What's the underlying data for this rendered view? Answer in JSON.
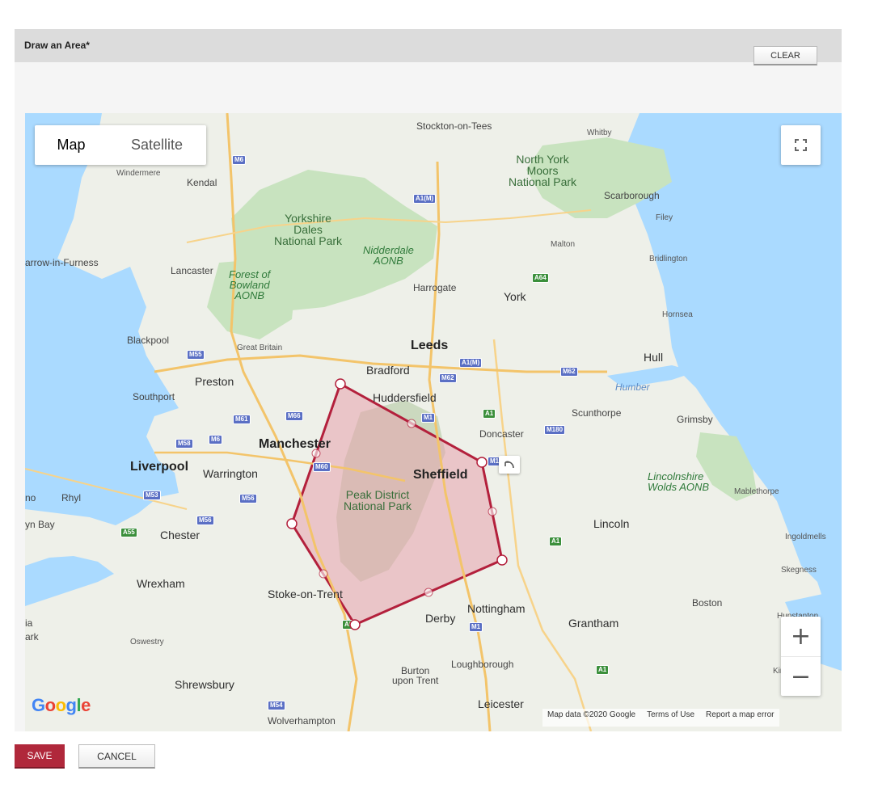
{
  "panel": {
    "title": "Draw an Area*",
    "clear_label": "CLEAR"
  },
  "map": {
    "type_controls": {
      "map": "Map",
      "satellite": "Satellite",
      "selected": "Map"
    },
    "zoom": {
      "in": "+",
      "out": "−"
    },
    "logo": "Google",
    "attribution": {
      "data": "Map data ©2020 Google",
      "terms": "Terms of Use",
      "report": "Report a map error"
    },
    "labels": {
      "stockton": "Stockton-on-Tees",
      "whitby": "Whitby",
      "north_york_moors": "North York\nMoors\nNational Park",
      "scarborough": "Scarborough",
      "filey": "Filey",
      "malton": "Malton",
      "bridlington": "Bridlington",
      "windermere": "Windermere",
      "kendal": "Kendal",
      "yorkshire_dales": "Yorkshire\nDales\nNational Park",
      "nidderdale": "Nidderdale\nAONB",
      "barrow": "arrow-in-Furness",
      "lancaster": "Lancaster",
      "forest_bowland": "Forest of\nBowland\nAONB",
      "harrogate": "Harrogate",
      "york": "York",
      "hornsea": "Hornsea",
      "blackpool": "Blackpool",
      "great_britain": "Great Britain",
      "leeds": "Leeds",
      "hull": "Hull",
      "preston": "Preston",
      "bradford": "Bradford",
      "humber": "Humber",
      "southport": "Southport",
      "huddersfield": "Huddersfield",
      "scunthorpe": "Scunthorpe",
      "grimsby": "Grimsby",
      "manchester": "Manchester",
      "doncaster": "Doncaster",
      "liverpool": "Liverpool",
      "warrington": "Warrington",
      "sheffield": "Sheffield",
      "lincolnshire_wolds": "Lincolnshire\nWolds AONB",
      "mablethorpe": "Mablethorpe",
      "no": "no",
      "rhyl": "Rhyl",
      "peak_district": "Peak District\nNational Park",
      "yn_bay": "yn Bay",
      "chester": "Chester",
      "lincoln": "Lincoln",
      "ingoldmells": "Ingoldmells",
      "skegness": "Skegness",
      "wrexham": "Wrexham",
      "stoke": "Stoke-on-Trent",
      "boston": "Boston",
      "ia": "ia",
      "ark": "ark",
      "derby": "Derby",
      "nottingham": "Nottingham",
      "grantham": "Grantham",
      "hunstanton": "Hunstanton",
      "oswestry": "Oswestry",
      "loughborough": "Loughborough",
      "kin": "King",
      "burton": "Burton\nupon Trent",
      "shrewsbury": "Shrewsbury",
      "leicester": "Leicester",
      "wolverhampton": "Wolverhampton"
    },
    "roads": {
      "m6a": "M6",
      "a1m_n": "A1(M)",
      "a1m_s": "A1(M)",
      "a64": "A64",
      "m55": "M55",
      "m62a": "M62",
      "m62b": "M62",
      "m61": "M61",
      "m66": "M66",
      "m1a": "M1",
      "a1": "A1",
      "m180": "M180",
      "m58": "M58",
      "m6b": "M6",
      "m60": "M60",
      "m53": "M53",
      "m56a": "M56",
      "m56b": "M56",
      "a55": "A55",
      "a1b": "A1",
      "m1b": "M1",
      "a1c": "A1",
      "m54": "M54",
      "m18": "M1",
      "a5": "A5"
    }
  },
  "actions": {
    "save": "SAVE",
    "cancel": "CANCEL"
  }
}
